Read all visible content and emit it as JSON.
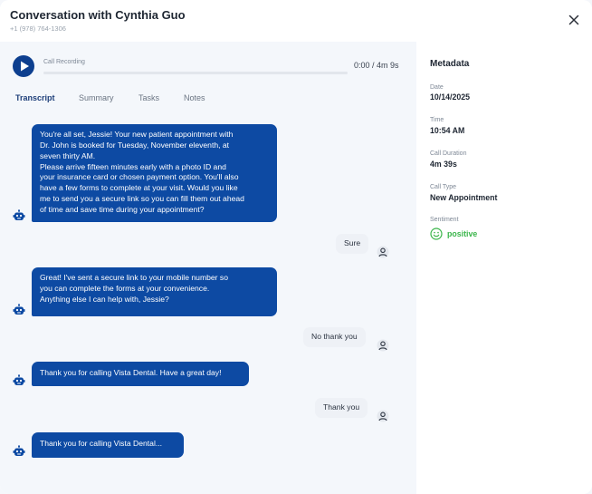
{
  "header": {
    "title": "Conversation with Cynthia Guo",
    "phone": "+1 (978) 764-1306"
  },
  "recording": {
    "label": "Call Recording",
    "time": "0:00 / 4m 9s",
    "progress": 0
  },
  "tabs": [
    {
      "label": "Transcript",
      "active": true
    },
    {
      "label": "Summary",
      "active": false
    },
    {
      "label": "Tasks",
      "active": false
    },
    {
      "label": "Notes",
      "active": false
    }
  ],
  "messages": [
    {
      "role": "bot",
      "lines": [
        "You're all set, Jessie! Your new patient appointment with",
        "Dr. John is booked for Tuesday, November eleventh, at",
        "seven thirty AM.",
        "Please arrive fifteen minutes early with a photo ID and",
        "your insurance card or chosen payment option. You'll also",
        "have a few forms to complete at your visit. Would you like",
        "me to send you a secure link so you can fill them out ahead",
        "of time and save time during your appointment?"
      ]
    },
    {
      "role": "user",
      "lines": [
        "Sure"
      ]
    },
    {
      "role": "bot",
      "lines": [
        "Great! I've sent a secure link to your mobile number so",
        "you can complete the forms at your convenience.",
        "Anything else I can help with, Jessie?"
      ]
    },
    {
      "role": "user",
      "lines": [
        "No thank you"
      ]
    },
    {
      "role": "bot",
      "lines": [
        "Thank you for calling Vista Dental. Have a great day!"
      ]
    },
    {
      "role": "user",
      "lines": [
        "Thank you"
      ]
    },
    {
      "role": "bot",
      "lines": [
        "Thank you for calling Vista Dental..."
      ]
    }
  ],
  "metadata": {
    "title": "Metadata",
    "date_label": "Date",
    "date": "10/14/2025",
    "time_label": "Time",
    "time": "10:54 AM",
    "duration_label": "Call Duration",
    "duration": "4m 39s",
    "type_label": "Call Type",
    "type": "New Appointment",
    "sentiment_label": "Sentiment",
    "sentiment": "positive"
  },
  "colors": {
    "bot_bubble": "#0d4aa3",
    "accent": "#0d3f8f",
    "positive": "#3ab54a"
  },
  "icons": {
    "close": "close-icon",
    "play": "play-icon",
    "bot": "robot-icon",
    "user": "user-icon",
    "sentiment": "smiley-icon"
  }
}
